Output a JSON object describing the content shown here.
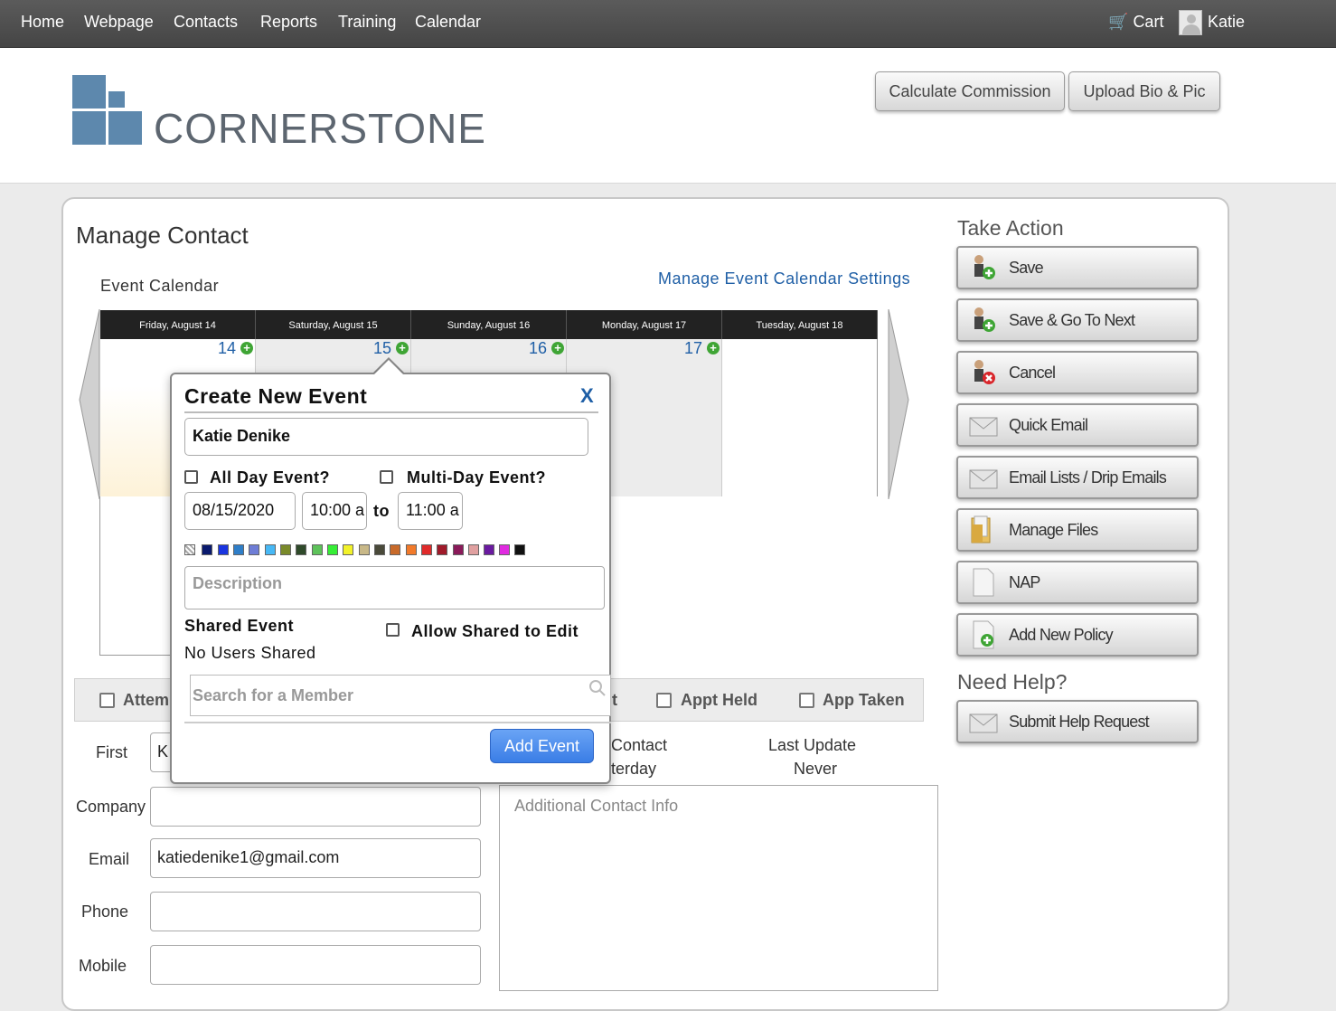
{
  "nav": {
    "items": [
      "Home",
      "Webpage",
      "Contacts",
      "Reports",
      "Training",
      "Calendar"
    ],
    "cart": "Cart",
    "user": "Katie"
  },
  "header": {
    "logo_text": "CORNERSTONE",
    "calc_commission": "Calculate Commission",
    "upload_bio": "Upload Bio & Pic",
    "brand_color": "#5d88ad"
  },
  "main": {
    "title": "Manage Contact",
    "event_calendar_label": "Event Calendar",
    "event_settings_link": "Manage Event Calendar Settings",
    "calendar": {
      "days": [
        {
          "header": "Friday, August 14",
          "num": "14"
        },
        {
          "header": "Saturday, August 15",
          "num": "15"
        },
        {
          "header": "Sunday, August 16",
          "num": "16"
        },
        {
          "header": "Monday, August 17",
          "num": "17"
        },
        {
          "header": "Tuesday, August 18",
          "num": ""
        }
      ]
    },
    "checkboxes": {
      "attempt": "Attem",
      "hidden_fragment": "t",
      "appt_held": "Appt Held",
      "app_taken": "App Taken"
    },
    "form": {
      "first_label": "First",
      "first_value": "K",
      "company_label": "Company",
      "email_label": "Email",
      "email_value": "katiedenike1@gmail.com",
      "phone_label": "Phone",
      "mobile_label": "Mobile",
      "last_contact_label": "Contact",
      "last_contact_value": "terday",
      "last_update_label": "Last Update",
      "last_update_value": "Never",
      "additional_placeholder": "Additional Contact Info"
    }
  },
  "sidebar": {
    "take_action": "Take Action",
    "actions": [
      "Save",
      "Save & Go To Next",
      "Cancel",
      "Quick Email",
      "Email Lists / Drip Emails",
      "Manage Files",
      "NAP",
      "Add New Policy"
    ],
    "need_help": "Need Help?",
    "help_button": "Submit Help Request"
  },
  "modal": {
    "title": "Create New Event",
    "close": "X",
    "event_name": "Katie Denike",
    "all_day": "All Day Event?",
    "multi_day": "Multi-Day Event?",
    "date": "08/15/2020",
    "start_time": "10:00 a",
    "to": "to",
    "end_time": "11:00 a",
    "colors": [
      "#0a1a6e",
      "#1a35e0",
      "#2f7ec8",
      "#6e7dd6",
      "#47b8f5",
      "#7a8a2a",
      "#2f4a2a",
      "#5ec25a",
      "#36ee36",
      "#f2f22a",
      "#c8b888",
      "#4a4a3a",
      "#c86a2a",
      "#f27a2a",
      "#e02a2a",
      "#a01a2a",
      "#8a1a5a",
      "#e0a0a0",
      "#6a1aa0",
      "#e02ae0",
      "#111111"
    ],
    "description_placeholder": "Description",
    "shared_event": "Shared Event",
    "no_users": "No Users Shared",
    "allow_shared": "Allow Shared to Edit",
    "search_placeholder": "Search for a Member",
    "add_button": "Add Event"
  }
}
